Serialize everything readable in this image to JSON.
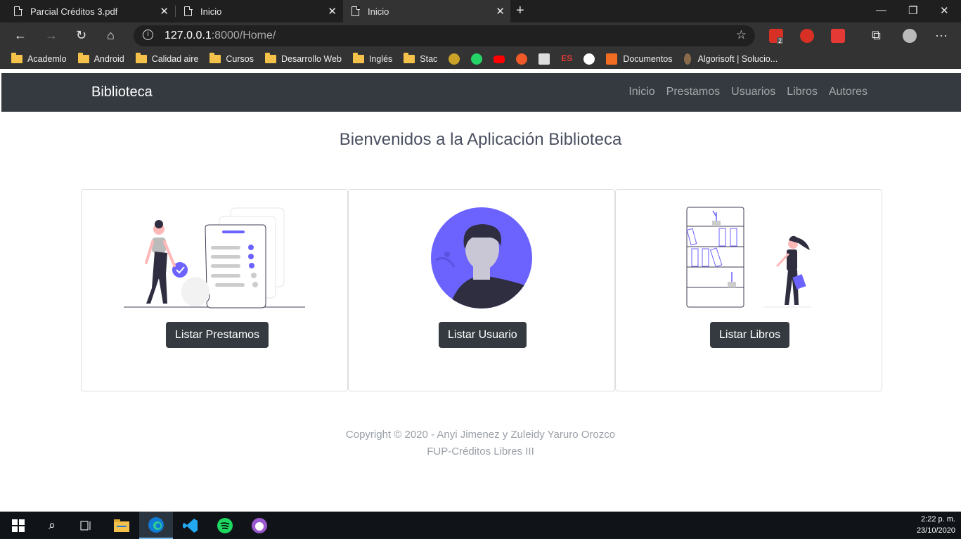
{
  "browser": {
    "tabs": [
      {
        "title": "Parcial Créditos 3.pdf",
        "active": false
      },
      {
        "title": "Inicio",
        "active": false
      },
      {
        "title": "Inicio",
        "active": true
      }
    ],
    "url_host": "127.0.0.1",
    "url_rest": ":8000/Home/",
    "mail_badge": "2",
    "bookmarks": [
      {
        "label": "Academlo",
        "icon": "folder-icon"
      },
      {
        "label": "Android",
        "icon": "folder-icon"
      },
      {
        "label": "Calidad aire",
        "icon": "folder-icon"
      },
      {
        "label": "Cursos",
        "icon": "folder-icon"
      },
      {
        "label": "Desarrollo Web",
        "icon": "folder-icon"
      },
      {
        "label": "Inglés",
        "icon": "folder-icon"
      },
      {
        "label": "Stac",
        "icon": "folder-icon"
      }
    ],
    "bookmarks_after": [
      {
        "label": "Documentos",
        "icon": "document-icon"
      },
      {
        "label": "Algorisoft | Solucio...",
        "icon": "site-icon"
      }
    ]
  },
  "app": {
    "brand": "Biblioteca",
    "nav": [
      "Inicio",
      "Prestamos",
      "Usuarios",
      "Libros",
      "Autores"
    ],
    "headline": "Bienvenidos a la Aplicación Biblioteca",
    "cards": [
      {
        "button": "Listar Prestamos",
        "image": "loan-checklist-illustration"
      },
      {
        "button": "Listar Usuario",
        "image": "user-avatar-illustration"
      },
      {
        "button": "Listar Libros",
        "image": "bookshelf-illustration"
      }
    ],
    "footer_line1": "Copyright © 2020 - Anyi Jimenez y Zuleidy Yaruro Orozco",
    "footer_line2": "FUP-Créditos Libres III"
  },
  "colors": {
    "accent": "#6c63ff",
    "navbar": "#343a40"
  },
  "taskbar": {
    "time": "2:22 p. m.",
    "date": "23/10/2020"
  }
}
